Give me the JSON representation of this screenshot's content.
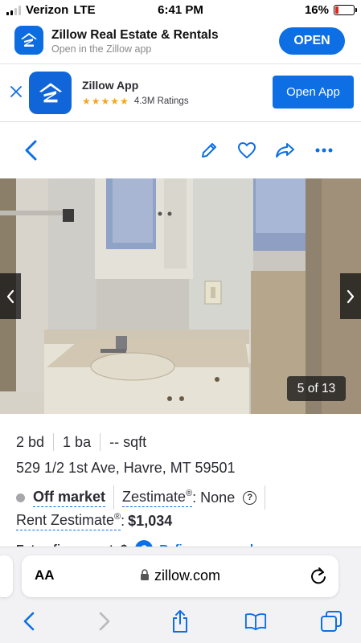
{
  "status_bar": {
    "carrier": "Verizon",
    "network": "LTE",
    "time": "6:41 PM",
    "battery_percent": "16%",
    "battery_level": 0.16,
    "battery_color": "#e0261c"
  },
  "smart_banner": {
    "title": "Zillow Real Estate & Rentals",
    "subtitle": "Open in the Zillow app",
    "open_label": "OPEN"
  },
  "app_banner": {
    "app_name": "Zillow App",
    "rating_stars": 5,
    "ratings_text": "4.3M Ratings",
    "open_label": "Open App"
  },
  "toolbar": {
    "icons": [
      "back-chevron-icon",
      "edit-pencil-icon",
      "heart-icon",
      "share-icon",
      "more-dots-icon"
    ]
  },
  "gallery": {
    "counter": "5 of 13"
  },
  "listing": {
    "beds": "2 bd",
    "baths": "1 ba",
    "sqft": "-- sqft",
    "address": "529 1/2 1st Ave, Havre, MT 59501",
    "status": "Off market",
    "zestimate_label": "Zestimate",
    "zestimate_reg": "®",
    "zestimate_value": ": None",
    "info_glyph": "?",
    "rent_zestimate_label": "Rent Zestimate",
    "rent_zestimate_reg": "®",
    "rent_zestimate_colon": ":",
    "rent_zestimate_value": "$1,034",
    "est_refi_label": "Est. refi payment: $",
    "refinance_label": "Refinance your loan"
  },
  "browser": {
    "aa_label": "AA",
    "url": "zillow.com"
  },
  "colors": {
    "accent": "#0d6fe3",
    "zillow_blue": "#1065d9",
    "off_market_dot": "#a7a6ab"
  }
}
